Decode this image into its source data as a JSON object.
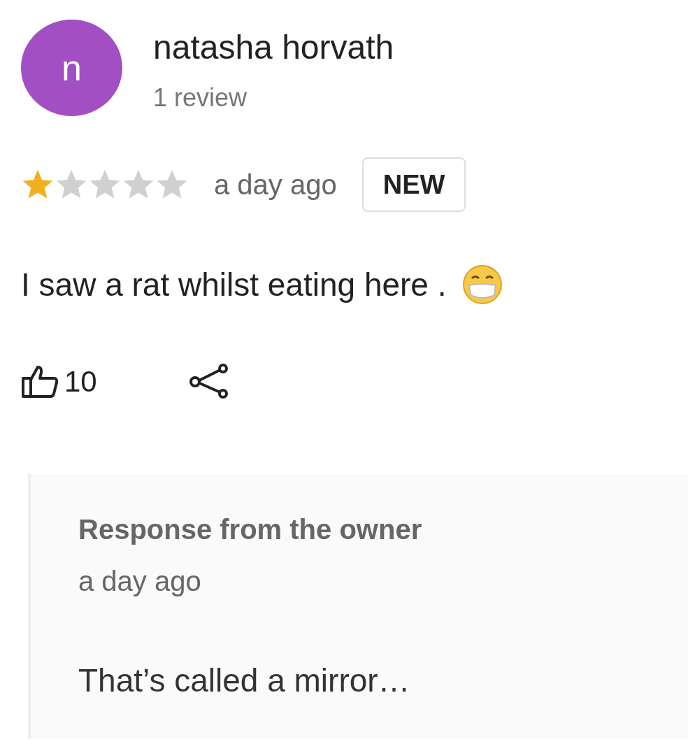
{
  "reviewer": {
    "initial": "n",
    "name": "natasha horvath",
    "review_count": "1 review"
  },
  "review": {
    "stars": 1,
    "time": "a day ago",
    "badge": "NEW",
    "text": "I saw a rat whilst eating here .",
    "likes": "10"
  },
  "owner_response": {
    "title": "Response from the owner",
    "time": "a day ago",
    "text": "That’s called a mirror…"
  }
}
